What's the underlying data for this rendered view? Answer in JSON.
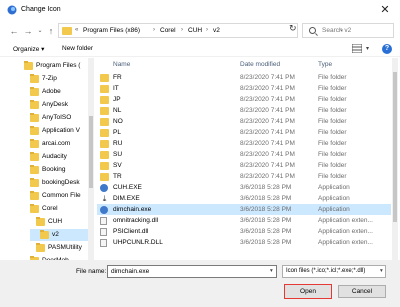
{
  "window": {
    "title": "Change Icon",
    "close_glyph": "✕"
  },
  "address": {
    "breadcrumbs": [
      "Program Files (x86)",
      "Corel",
      "CUH",
      "v2"
    ],
    "search_placeholder": "Search v2"
  },
  "commands": {
    "organize": "Organize ▾",
    "new_folder": "New folder"
  },
  "nav_pane": {
    "items": [
      {
        "label": "Program Files (",
        "selected": false
      },
      {
        "label": "7-Zip",
        "selected": false
      },
      {
        "label": "Adobe",
        "selected": false
      },
      {
        "label": "AnyDesk",
        "selected": false
      },
      {
        "label": "AnyToISO",
        "selected": false
      },
      {
        "label": "Application V",
        "selected": false
      },
      {
        "label": "arcai.com",
        "selected": false
      },
      {
        "label": "Audacity",
        "selected": false
      },
      {
        "label": "Booking",
        "selected": false
      },
      {
        "label": "bookingDesk",
        "selected": false
      },
      {
        "label": "Common File",
        "selected": false
      },
      {
        "label": "Corel",
        "selected": false
      },
      {
        "label": "CUH",
        "selected": false
      },
      {
        "label": "v2",
        "selected": true
      },
      {
        "label": "PASMUtility",
        "selected": false
      },
      {
        "label": "DeerMob",
        "selected": false
      }
    ]
  },
  "columns": {
    "name": "Name",
    "date": "Date modified",
    "type": "Type"
  },
  "files": [
    {
      "name": "FR",
      "date": "8/23/2020 7:41 PM",
      "type": "File folder",
      "icon": "folder-icon"
    },
    {
      "name": "IT",
      "date": "8/23/2020 7:41 PM",
      "type": "File folder",
      "icon": "folder-icon"
    },
    {
      "name": "JP",
      "date": "8/23/2020 7:41 PM",
      "type": "File folder",
      "icon": "folder-icon"
    },
    {
      "name": "NL",
      "date": "8/23/2020 7:41 PM",
      "type": "File folder",
      "icon": "folder-icon"
    },
    {
      "name": "NO",
      "date": "8/23/2020 7:41 PM",
      "type": "File folder",
      "icon": "folder-icon"
    },
    {
      "name": "PL",
      "date": "8/23/2020 7:41 PM",
      "type": "File folder",
      "icon": "folder-icon"
    },
    {
      "name": "RU",
      "date": "8/23/2020 7:41 PM",
      "type": "File folder",
      "icon": "folder-icon"
    },
    {
      "name": "SU",
      "date": "8/23/2020 7:41 PM",
      "type": "File folder",
      "icon": "folder-icon"
    },
    {
      "name": "SV",
      "date": "8/23/2020 7:41 PM",
      "type": "File folder",
      "icon": "folder-icon"
    },
    {
      "name": "TR",
      "date": "8/23/2020 7:41 PM",
      "type": "File folder",
      "icon": "folder-icon"
    },
    {
      "name": "CUH.EXE",
      "date": "3/6/2018 5:28 PM",
      "type": "Application",
      "icon": "exe-icon"
    },
    {
      "name": "DIM.EXE",
      "date": "3/6/2018 5:28 PM",
      "type": "Application",
      "icon": "download-icon"
    },
    {
      "name": "dimchain.exe",
      "date": "3/6/2018 5:28 PM",
      "type": "Application",
      "icon": "exe-icon",
      "selected": true
    },
    {
      "name": "omnitracking.dll",
      "date": "3/6/2018 5:28 PM",
      "type": "Application exten...",
      "icon": "dll-icon"
    },
    {
      "name": "PSIClient.dll",
      "date": "3/6/2018 5:28 PM",
      "type": "Application exten...",
      "icon": "dll-icon"
    },
    {
      "name": "UHPCUNLR.DLL",
      "date": "3/6/2018 5:28 PM",
      "type": "Application exten...",
      "icon": "dll-icon"
    }
  ],
  "footer": {
    "file_name_label": "File name:",
    "file_name_value": "dimchain.exe",
    "filter": "Icon files (*.ico;*.icl;*.exe;*.dll)",
    "open_label": "Open",
    "cancel_label": "Cancel"
  },
  "colors": {
    "selection": "#cce8ff",
    "folder": "#f2c94c",
    "highlight_border": "#e53935"
  }
}
